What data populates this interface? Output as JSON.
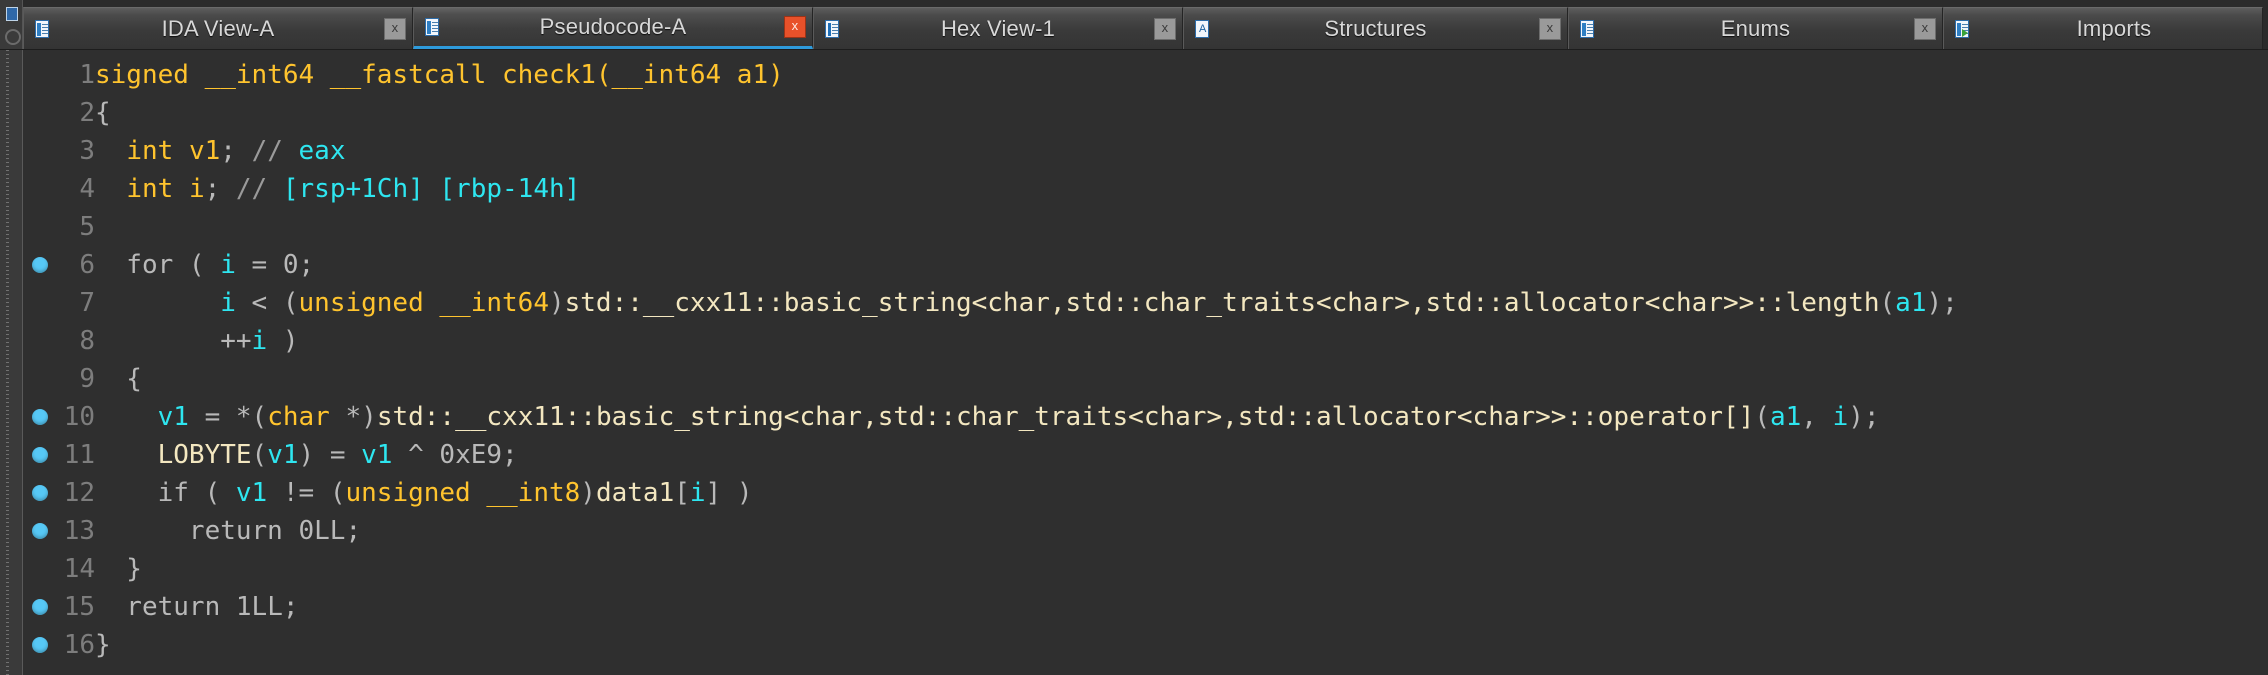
{
  "window": {
    "app": "IDA Pro",
    "active_view": "Pseudocode-A"
  },
  "tabs": [
    {
      "label": "IDA View-A",
      "icon": "document-icon",
      "close_label": "x",
      "active": false
    },
    {
      "label": "Pseudocode-A",
      "icon": "document-icon",
      "close_label": "x",
      "active": true
    },
    {
      "label": "Hex View-1",
      "icon": "hex-document-icon",
      "close_label": "x",
      "active": false
    },
    {
      "label": "Structures",
      "icon": "structures-icon",
      "close_label": "x",
      "active": false
    },
    {
      "label": "Enums",
      "icon": "enums-icon",
      "close_label": "x",
      "active": false
    },
    {
      "label": "Imports",
      "icon": "imports-icon",
      "close_label": "",
      "active": false
    }
  ],
  "colors": {
    "background": "#2f2f2f",
    "tabbar_background": "#2b2b2b",
    "active_tab_underline": "#2e9bdc",
    "breakpoint_dot": "#57c8f5",
    "keyword": "#ffc42e",
    "variable": "#2ee6f0",
    "library_ident": "#f3e7c0",
    "punctuation": "#b9b9b9",
    "line_number": "#7d7d7d",
    "comment": "#9a9a9a"
  },
  "code": {
    "language": "c-pseudocode",
    "function_name": "check1",
    "lines": [
      {
        "no": "1",
        "bp": false,
        "tokens": [
          {
            "t": "signed __int64 __fastcall check1(__int64 a1)",
            "c": "kw"
          }
        ]
      },
      {
        "no": "2",
        "bp": false,
        "tokens": [
          {
            "t": "{",
            "c": "punct"
          }
        ]
      },
      {
        "no": "3",
        "bp": false,
        "tokens": [
          {
            "t": "  ",
            "c": "plain"
          },
          {
            "t": "int",
            "c": "kw"
          },
          {
            "t": " ",
            "c": "plain"
          },
          {
            "t": "v1",
            "c": "kw"
          },
          {
            "t": "; ",
            "c": "punct"
          },
          {
            "t": "// ",
            "c": "cmt"
          },
          {
            "t": "eax",
            "c": "cmt2"
          }
        ]
      },
      {
        "no": "4",
        "bp": false,
        "tokens": [
          {
            "t": "  ",
            "c": "plain"
          },
          {
            "t": "int",
            "c": "kw"
          },
          {
            "t": " ",
            "c": "plain"
          },
          {
            "t": "i",
            "c": "kw"
          },
          {
            "t": "; ",
            "c": "punct"
          },
          {
            "t": "// ",
            "c": "cmt"
          },
          {
            "t": "[rsp+1Ch] [rbp-14h]",
            "c": "cmt2"
          }
        ]
      },
      {
        "no": "5",
        "bp": false,
        "tokens": [
          {
            "t": "",
            "c": "plain"
          }
        ]
      },
      {
        "no": "6",
        "bp": true,
        "tokens": [
          {
            "t": "  for ( ",
            "c": "punct"
          },
          {
            "t": "i",
            "c": "var"
          },
          {
            "t": " = 0;",
            "c": "punct"
          }
        ]
      },
      {
        "no": "7",
        "bp": false,
        "tokens": [
          {
            "t": "        ",
            "c": "plain"
          },
          {
            "t": "i",
            "c": "var"
          },
          {
            "t": " < (",
            "c": "punct"
          },
          {
            "t": "unsigned __int64",
            "c": "kw"
          },
          {
            "t": ")",
            "c": "punct"
          },
          {
            "t": "std::__cxx11::basic_string<char,std::char_traits<char>,std::allocator<char>>::length",
            "c": "lib"
          },
          {
            "t": "(",
            "c": "punct"
          },
          {
            "t": "a1",
            "c": "var"
          },
          {
            "t": ");",
            "c": "punct"
          }
        ]
      },
      {
        "no": "8",
        "bp": false,
        "tokens": [
          {
            "t": "        ++",
            "c": "punct"
          },
          {
            "t": "i",
            "c": "var"
          },
          {
            "t": " )",
            "c": "punct"
          }
        ]
      },
      {
        "no": "9",
        "bp": false,
        "tokens": [
          {
            "t": "  {",
            "c": "punct"
          }
        ]
      },
      {
        "no": "10",
        "bp": true,
        "tokens": [
          {
            "t": "    ",
            "c": "plain"
          },
          {
            "t": "v1",
            "c": "var"
          },
          {
            "t": " = *(",
            "c": "punct"
          },
          {
            "t": "char",
            "c": "kw"
          },
          {
            "t": " *)",
            "c": "punct"
          },
          {
            "t": "std::__cxx11::basic_string<char,std::char_traits<char>,std::allocator<char>>::operator[]",
            "c": "lib"
          },
          {
            "t": "(",
            "c": "punct"
          },
          {
            "t": "a1",
            "c": "var"
          },
          {
            "t": ", ",
            "c": "punct"
          },
          {
            "t": "i",
            "c": "var"
          },
          {
            "t": ");",
            "c": "punct"
          }
        ]
      },
      {
        "no": "11",
        "bp": true,
        "tokens": [
          {
            "t": "    ",
            "c": "plain"
          },
          {
            "t": "LOBYTE",
            "c": "lib"
          },
          {
            "t": "(",
            "c": "punct"
          },
          {
            "t": "v1",
            "c": "var"
          },
          {
            "t": ") = ",
            "c": "punct"
          },
          {
            "t": "v1",
            "c": "var"
          },
          {
            "t": " ^ ",
            "c": "punct"
          },
          {
            "t": "0xE9",
            "c": "num"
          },
          {
            "t": ";",
            "c": "punct"
          }
        ]
      },
      {
        "no": "12",
        "bp": true,
        "tokens": [
          {
            "t": "    if ( ",
            "c": "punct"
          },
          {
            "t": "v1",
            "c": "var"
          },
          {
            "t": " != (",
            "c": "punct"
          },
          {
            "t": "unsigned __int8",
            "c": "kw"
          },
          {
            "t": ")",
            "c": "punct"
          },
          {
            "t": "data1",
            "c": "lib"
          },
          {
            "t": "[",
            "c": "punct"
          },
          {
            "t": "i",
            "c": "var"
          },
          {
            "t": "] )",
            "c": "punct"
          }
        ]
      },
      {
        "no": "13",
        "bp": true,
        "tokens": [
          {
            "t": "      return ",
            "c": "punct"
          },
          {
            "t": "0LL",
            "c": "num"
          },
          {
            "t": ";",
            "c": "punct"
          }
        ]
      },
      {
        "no": "14",
        "bp": false,
        "tokens": [
          {
            "t": "  }",
            "c": "punct"
          }
        ]
      },
      {
        "no": "15",
        "bp": true,
        "tokens": [
          {
            "t": "  return ",
            "c": "punct"
          },
          {
            "t": "1LL",
            "c": "num"
          },
          {
            "t": ";",
            "c": "punct"
          }
        ]
      },
      {
        "no": "16",
        "bp": true,
        "tokens": [
          {
            "t": "}",
            "c": "punct"
          }
        ]
      }
    ]
  }
}
